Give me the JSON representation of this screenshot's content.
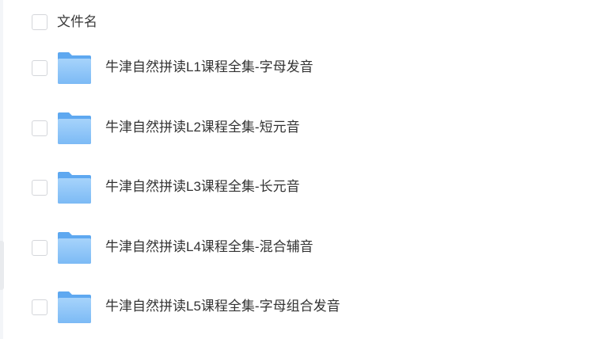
{
  "header": {
    "name_label": "文件名"
  },
  "files": [
    {
      "name": "牛津自然拼读L1课程全集-字母发音",
      "icon": "folder-icon"
    },
    {
      "name": "牛津自然拼读L2课程全集-短元音",
      "icon": "folder-icon"
    },
    {
      "name": "牛津自然拼读L3课程全集-长元音",
      "icon": "folder-icon"
    },
    {
      "name": "牛津自然拼读L4课程全集-混合辅音",
      "icon": "folder-icon"
    },
    {
      "name": "牛津自然拼读L5课程全集-字母组合发音",
      "icon": "folder-icon"
    }
  ],
  "colors": {
    "text": "#333333",
    "checkbox_border": "#d4d6da",
    "folder_back": "#5ea8f0",
    "folder_front_top": "#a6d3fb",
    "folder_front_bottom": "#7cbaf5"
  }
}
